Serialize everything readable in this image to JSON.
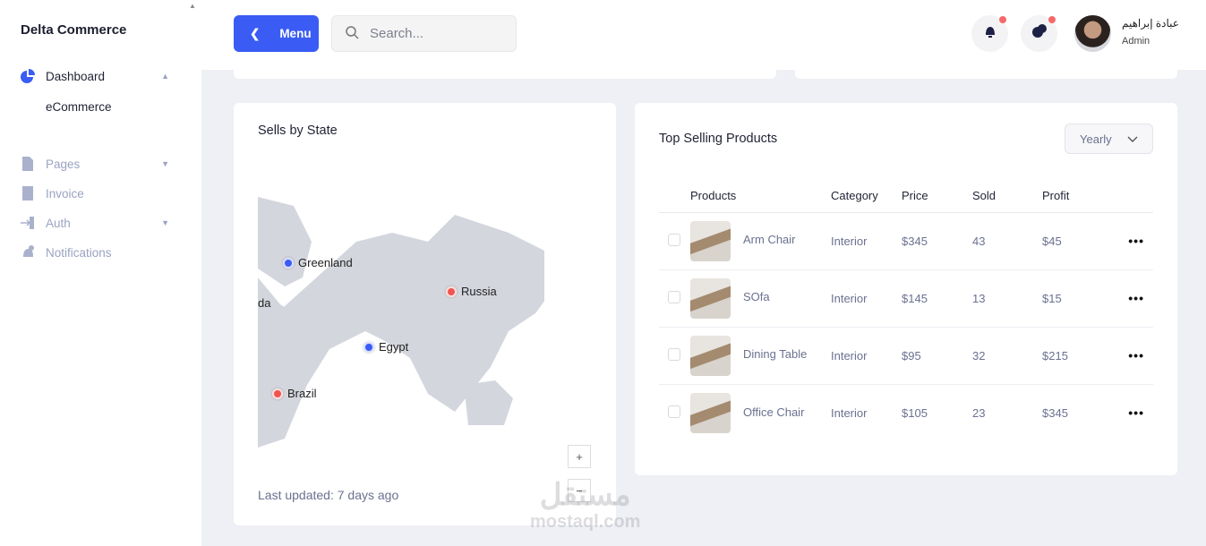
{
  "brand": "Delta Commerce",
  "sidebar": {
    "items": [
      {
        "label": "Dashboard",
        "icon": "pie-chart-icon",
        "active": true
      },
      {
        "label": "eCommerce"
      },
      {
        "label": "Pages",
        "icon": "file-icon"
      },
      {
        "label": "Invoice",
        "icon": "invoice-icon"
      },
      {
        "label": "Auth",
        "icon": "login-icon"
      },
      {
        "label": "Notifications",
        "icon": "bell-icon"
      }
    ]
  },
  "header": {
    "menu_label": "Menu",
    "search_placeholder": "Search...",
    "user_name": "عبادة إبراهيم",
    "user_role": "Admin"
  },
  "map_card": {
    "title": "Sells by State",
    "markers": [
      {
        "label": "Greenland",
        "color": "#3a5cf5"
      },
      {
        "label": "Russia",
        "color": "#f0544f"
      },
      {
        "label": "da",
        "color": ""
      },
      {
        "label": "Egypt",
        "color": "#3a5cf5"
      },
      {
        "label": "Brazil",
        "color": "#f0544f"
      }
    ],
    "zoom_in": "+",
    "zoom_out": "−",
    "updated": "Last updated: 7 days ago"
  },
  "products_card": {
    "title": "Top Selling Products",
    "period": "Yearly",
    "columns": [
      "Products",
      "Category",
      "Price",
      "Sold",
      "Profit"
    ],
    "rows": [
      {
        "name": "Arm Chair",
        "category": "Interior",
        "price": "$345",
        "sold": "43",
        "profit": "$45"
      },
      {
        "name": "SOfa",
        "category": "Interior",
        "price": "$145",
        "sold": "13",
        "profit": "$15"
      },
      {
        "name": "Dining Table",
        "category": "Interior",
        "price": "$95",
        "sold": "32",
        "profit": "$215"
      },
      {
        "name": "Office Chair",
        "category": "Interior",
        "price": "$105",
        "sold": "23",
        "profit": "$345"
      }
    ],
    "more": "•••"
  },
  "watermark": {
    "ar": "مستقل",
    "en": "mostaql.com"
  }
}
